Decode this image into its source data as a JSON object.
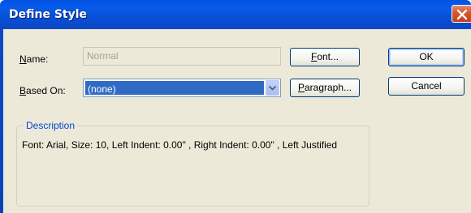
{
  "window": {
    "title": "Define Style"
  },
  "form": {
    "name_label_prefix": "",
    "name_label_underlined": "N",
    "name_label_rest": "ame:",
    "name_value": "Normal",
    "based_on_label_prefix": "",
    "based_on_label_underlined": "B",
    "based_on_label_rest": "ased On:",
    "based_on_value": "(none)"
  },
  "buttons": {
    "font_underlined": "F",
    "font_rest": "ont...",
    "paragraph_underlined": "P",
    "paragraph_rest": "aragraph...",
    "ok": "OK",
    "cancel": "Cancel"
  },
  "description": {
    "caption": "Description",
    "text": "Font: Arial, Size: 10, Left Indent: 0.00\" , Right Indent: 0.00\" , Left Justified"
  },
  "colors": {
    "titlebar": "#0a4fd8",
    "selection": "#316ac5",
    "dialog_bg": "#ece9d8",
    "group_caption": "#0046d5"
  },
  "icons": {
    "close": "close-icon",
    "dropdown": "chevron-down-icon"
  }
}
